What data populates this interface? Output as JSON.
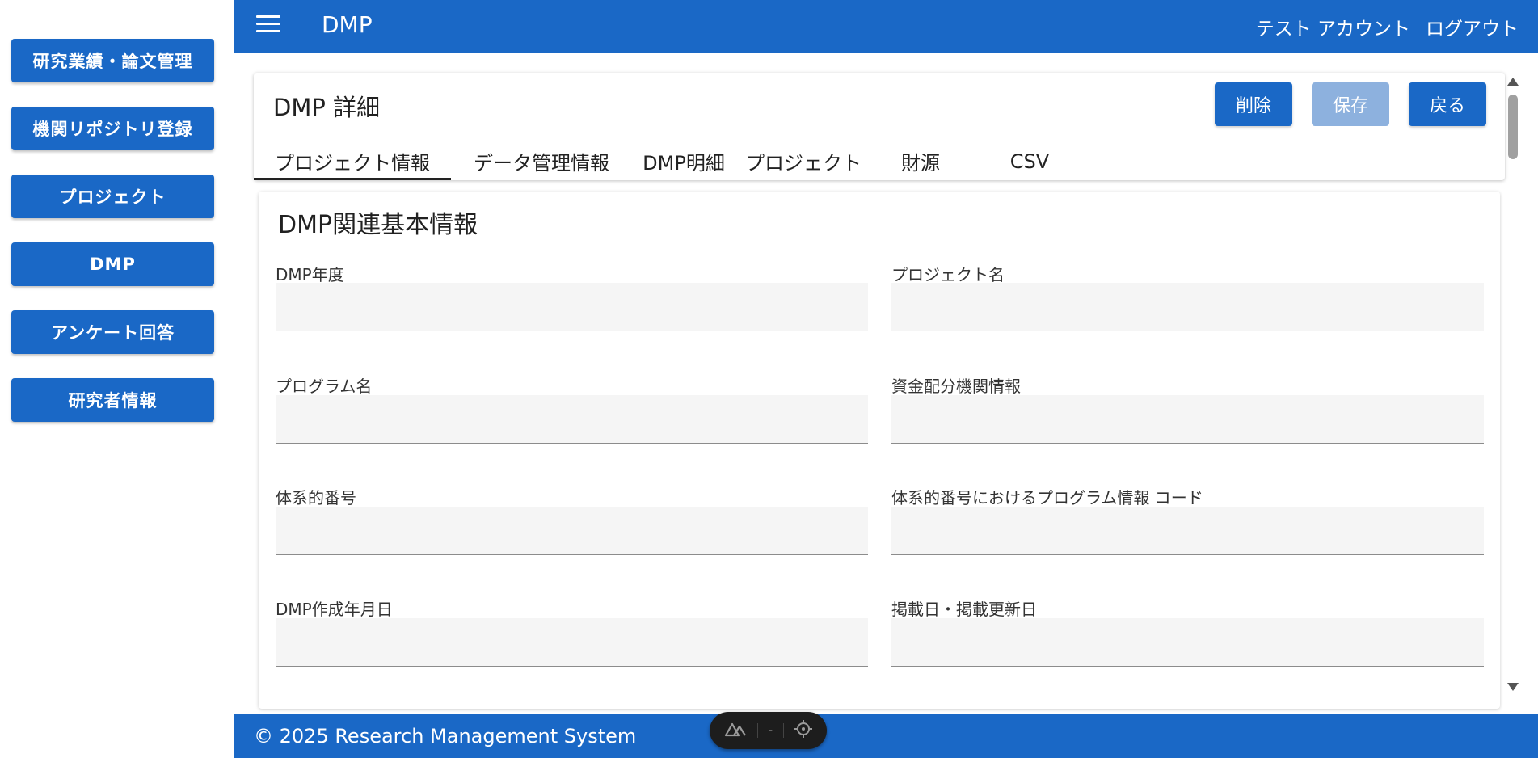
{
  "sidebar": {
    "items": [
      {
        "label": "研究業績・論文管理"
      },
      {
        "label": "機関リポジトリ登録"
      },
      {
        "label": "プロジェクト"
      },
      {
        "label": "DMP"
      },
      {
        "label": "アンケート回答"
      },
      {
        "label": "研究者情報"
      }
    ]
  },
  "header": {
    "title": "DMP",
    "account": "テスト アカウント",
    "logout": "ログアウト"
  },
  "page": {
    "title": "DMP 詳細",
    "buttons": {
      "delete": "削除",
      "save": "保存",
      "back": "戻る"
    },
    "tabs": [
      {
        "label": "プロジェクト情報"
      },
      {
        "label": "データ管理情報"
      },
      {
        "label": "DMP明細"
      },
      {
        "label": "プロジェクト"
      },
      {
        "label": "財源"
      },
      {
        "label": "CSV"
      }
    ]
  },
  "section": {
    "title": "DMP関連基本情報",
    "fields": [
      {
        "label": "DMP年度",
        "value": ""
      },
      {
        "label": "プロジェクト名",
        "value": ""
      },
      {
        "label": "プログラム名",
        "value": ""
      },
      {
        "label": "資金配分機関情報",
        "value": ""
      },
      {
        "label": "体系的番号",
        "value": ""
      },
      {
        "label": "体系的番号におけるプログラム情報 コード",
        "value": ""
      },
      {
        "label": "DMP作成年月日",
        "value": ""
      },
      {
        "label": "掲載日・掲載更新日",
        "value": ""
      }
    ]
  },
  "footer": {
    "copyright": "© 2025 Research Management System"
  },
  "devbar": {
    "placeholder": "-"
  },
  "colors": {
    "primary": "#1a68c6",
    "disabled": "#8db1de",
    "field_bg": "#f5f5f5"
  }
}
